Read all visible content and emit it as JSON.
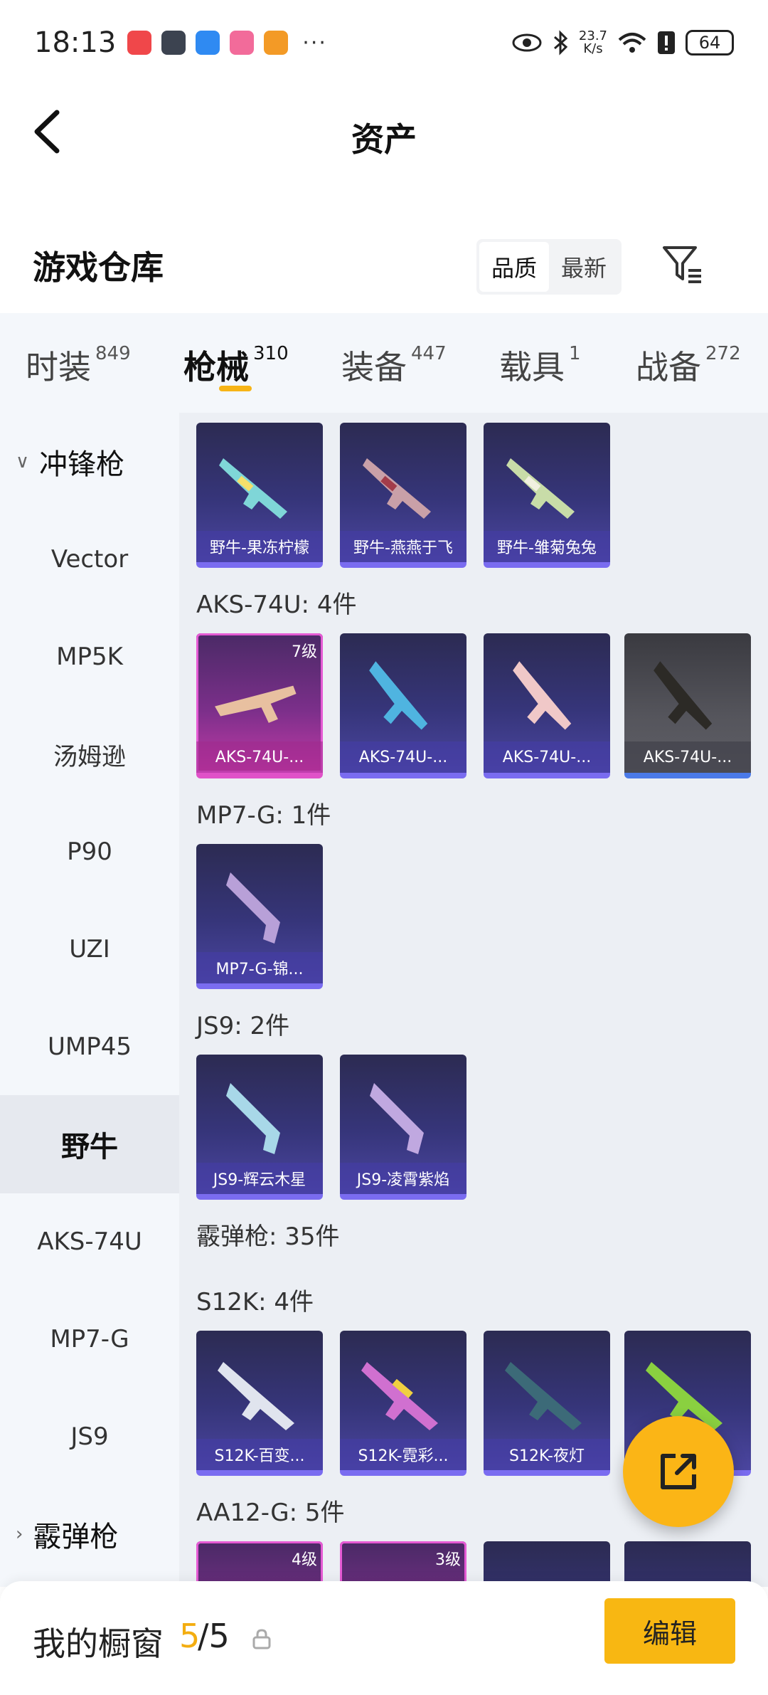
{
  "status_bar": {
    "time": "18:13",
    "net_speed": "23.7",
    "net_unit": "K/s",
    "battery": "64",
    "more": "···"
  },
  "header": {
    "title": "资产",
    "back_icon": "chevron-left-icon"
  },
  "warehouse": {
    "title": "游戏仓库",
    "sort_options": [
      "品质",
      "最新"
    ],
    "active_sort": "品质",
    "filter_icon": "filter-icon"
  },
  "tabs": [
    {
      "label": "时装",
      "count": "849"
    },
    {
      "label": "枪械",
      "count": "310"
    },
    {
      "label": "装备",
      "count": "447"
    },
    {
      "label": "载具",
      "count": "1"
    },
    {
      "label": "战备",
      "count": "272"
    }
  ],
  "active_tab": "枪械",
  "sidebar": {
    "group_smg": "冲锋枪",
    "items": [
      "Vector",
      "MP5K",
      "汤姆逊",
      "P90",
      "UZI",
      "UMP45",
      "野牛",
      "AKS-74U",
      "MP7-G",
      "JS9"
    ],
    "selected": "野牛",
    "group_shotgun": "霰弹枪"
  },
  "sections": {
    "bison_cards": [
      "野牛-果冻柠檬",
      "野牛-燕燕于飞",
      "野牛-雏菊兔兔"
    ],
    "aks_label": "AKS-74U: 4件",
    "aks_cards": [
      "AKS-74U-...",
      "AKS-74U-...",
      "AKS-74U-...",
      "AKS-74U-..."
    ],
    "aks_level": "7级",
    "mp7_label": "MP7-G: 1件",
    "mp7_cards": [
      "MP7-G-锦..."
    ],
    "js9_label": "JS9: 2件",
    "js9_cards": [
      "JS9-辉云木星",
      "JS9-凌霄紫焰"
    ],
    "shotgun_label": "霰弹枪: 35件",
    "s12k_label": "S12K: 4件",
    "s12k_cards": [
      "S12K-百变...",
      "S12K-霓彩...",
      "S12K-夜灯"
    ],
    "aa12_label": "AA12-G: 5件",
    "aa12_levels": [
      "4级",
      "3级"
    ]
  },
  "bottom_bar": {
    "label": "我的橱窗",
    "current": "5",
    "total": "/5",
    "edit_label": "编辑"
  },
  "colors": {
    "accent": "#f8b712",
    "card_blue": "#36357a",
    "card_pink": "#c23aa6"
  }
}
